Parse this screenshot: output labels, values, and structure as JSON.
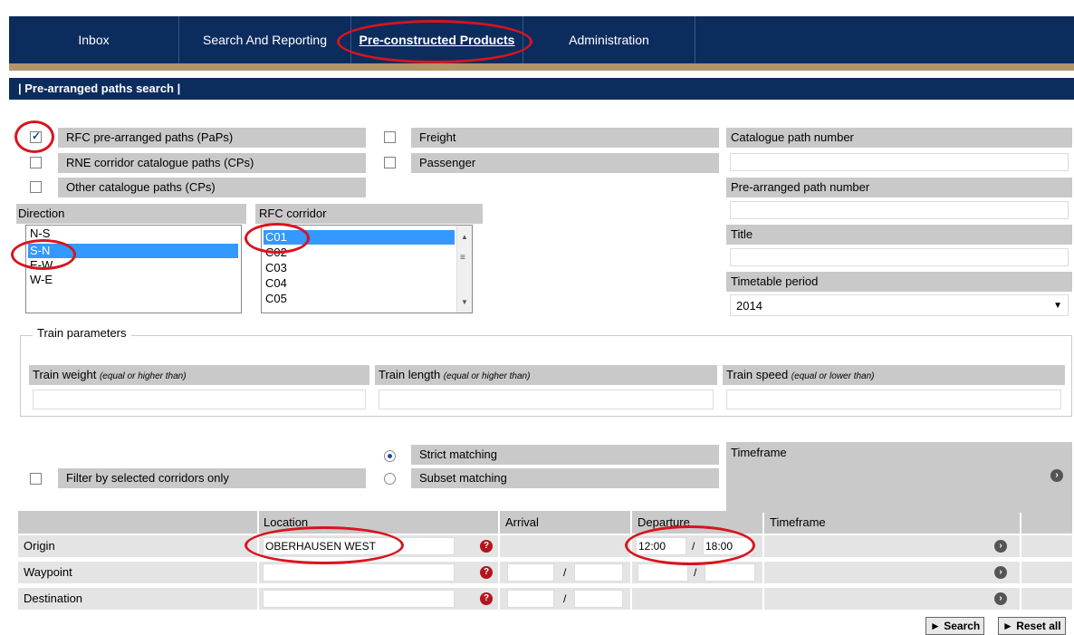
{
  "nav": {
    "tabs": [
      {
        "label": "Inbox"
      },
      {
        "label": "Search And Reporting"
      },
      {
        "label": "Pre-constructed Products"
      },
      {
        "label": "Administration"
      }
    ]
  },
  "section_title": "| Pre-arranged paths search |",
  "path_types": {
    "rfc": "RFC pre-arranged paths (PaPs)",
    "rne": "RNE corridor catalogue paths (CPs)",
    "other": "Other catalogue paths (CPs)"
  },
  "traffic": {
    "freight": "Freight",
    "passenger": "Passenger"
  },
  "right_fields": {
    "catalogue_label": "Catalogue path number",
    "paparranged_label": "Pre-arranged path number",
    "title_label": "Title",
    "timetable_label": "Timetable period",
    "timetable_value": "2014"
  },
  "direction": {
    "label": "Direction",
    "options": [
      "N-S",
      "S-N",
      "E-W",
      "W-E"
    ],
    "selected": "S-N"
  },
  "corridor": {
    "label": "RFC corridor",
    "options": [
      "C01",
      "C02",
      "C03",
      "C04",
      "C05"
    ],
    "selected": "C01"
  },
  "train_params": {
    "legend": "Train parameters",
    "weight_label": "Train weight",
    "weight_hint": "(equal or higher than)",
    "length_label": "Train length",
    "length_hint": "(equal or higher than)",
    "speed_label": "Train speed",
    "speed_hint": "(equal or lower than)"
  },
  "matching": {
    "strict": "Strict matching",
    "subset": "Subset matching",
    "filter": "Filter by selected corridors only",
    "timeframe": "Timeframe"
  },
  "route_table": {
    "headers": {
      "location": "Location",
      "arrival": "Arrival",
      "departure": "Departure",
      "timeframe": "Timeframe"
    },
    "rows": [
      {
        "label": "Origin",
        "location": "OBERHAUSEN WEST",
        "dep_from": "12:00",
        "dep_to": "18:00",
        "sep": "/"
      },
      {
        "label": "Waypoint",
        "location": "",
        "sep": "/"
      },
      {
        "label": "Destination",
        "location": "",
        "sep": "/"
      }
    ]
  },
  "buttons": {
    "search": "► Search",
    "reset": "► Reset all"
  }
}
